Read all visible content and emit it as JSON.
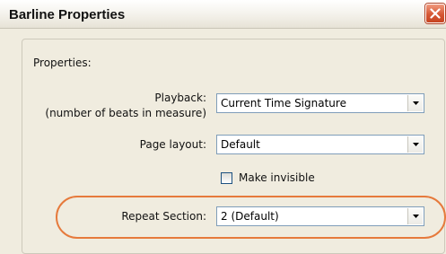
{
  "window": {
    "title": "Barline Properties",
    "close_icon": "close-icon",
    "accent_color": "#d65835"
  },
  "group": {
    "legend": "Properties:"
  },
  "playback": {
    "label_line1": "Playback:",
    "label_line2": "(number of beats in measure)",
    "value": "Current Time Signature"
  },
  "page_layout": {
    "label": "Page layout:",
    "value": "Default"
  },
  "make_invisible": {
    "label": "Make invisible",
    "checked": false
  },
  "repeat_section": {
    "label": "Repeat Section:",
    "value": "2 (Default)",
    "highlight_color": "#e67a3c"
  }
}
